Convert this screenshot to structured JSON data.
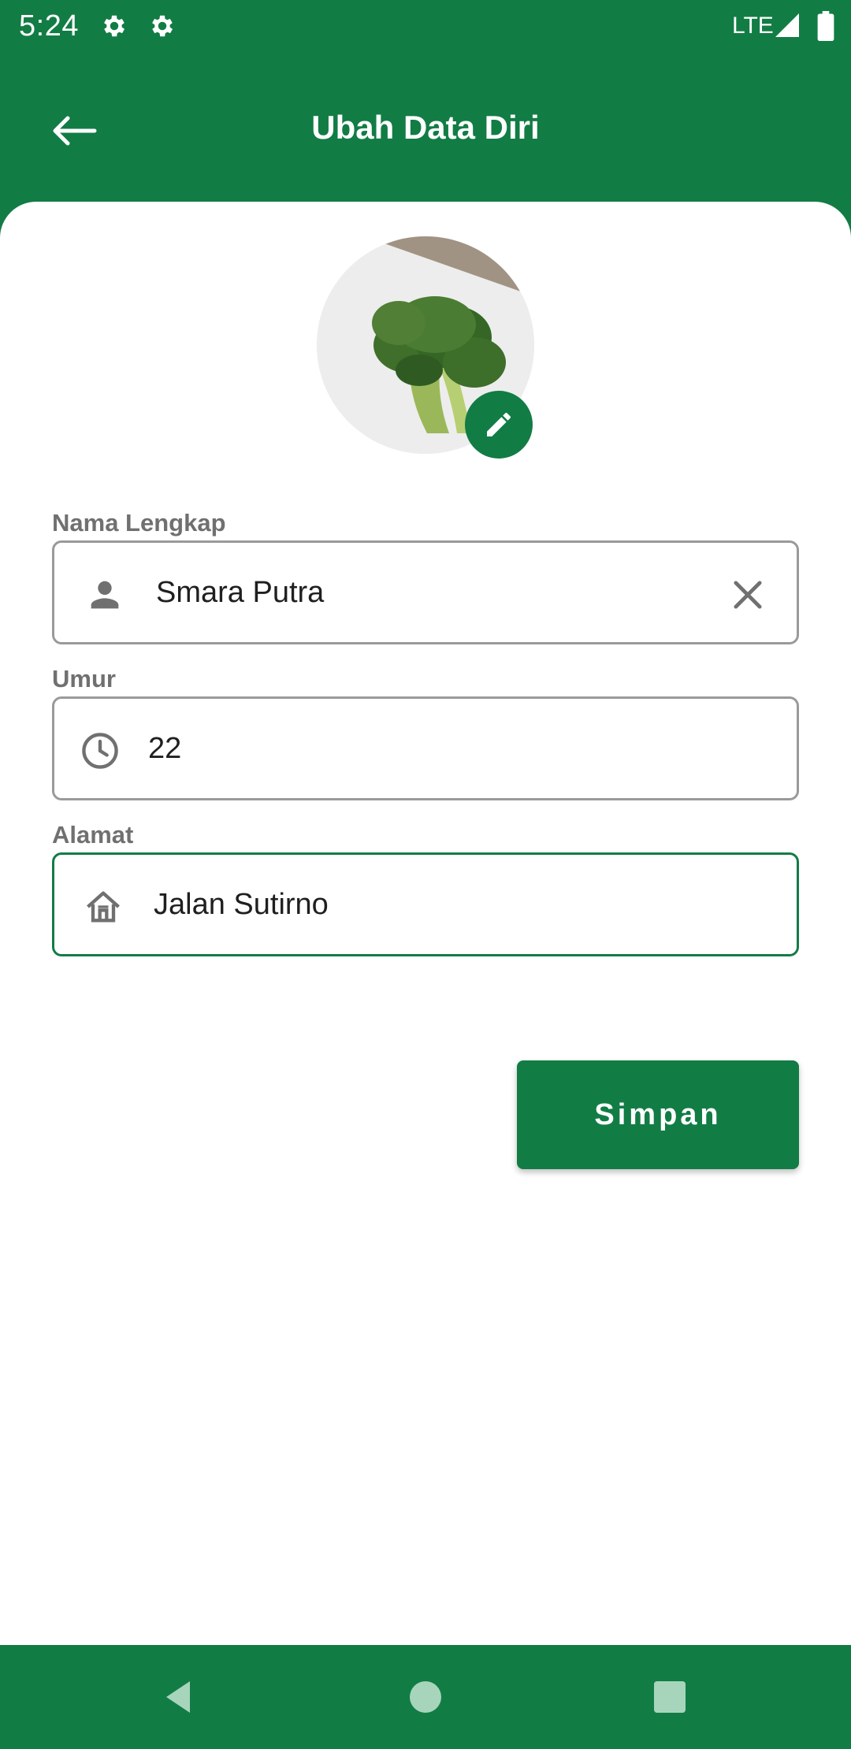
{
  "status_bar": {
    "time": "5:24",
    "network": "LTE",
    "icons": [
      "settings-gear-icon",
      "settings-gear-icon",
      "signal-icon",
      "battery-icon"
    ]
  },
  "app_bar": {
    "title": "Ubah Data Diri",
    "back_icon": "arrow-back-icon"
  },
  "profile": {
    "photo": "broccoli-photo",
    "edit_icon": "pencil-icon"
  },
  "form": {
    "name": {
      "label": "Nama Lengkap",
      "value": "Smara Putra",
      "icon": "person-icon",
      "clear_icon": "close-icon"
    },
    "age": {
      "label": "Umur",
      "value": "22",
      "icon": "clock-icon"
    },
    "address": {
      "label": "Alamat",
      "value": "Jalan Sutirno",
      "icon": "home-icon",
      "focused": true
    }
  },
  "actions": {
    "save_label": "Simpan"
  },
  "nav_bar": {
    "icons": [
      "back-triangle-icon",
      "home-circle-icon",
      "recents-square-icon"
    ]
  },
  "colors": {
    "primary": "#127c45",
    "surface": "#ffffff",
    "label": "#707070",
    "field_border": "#9a9a9a"
  }
}
